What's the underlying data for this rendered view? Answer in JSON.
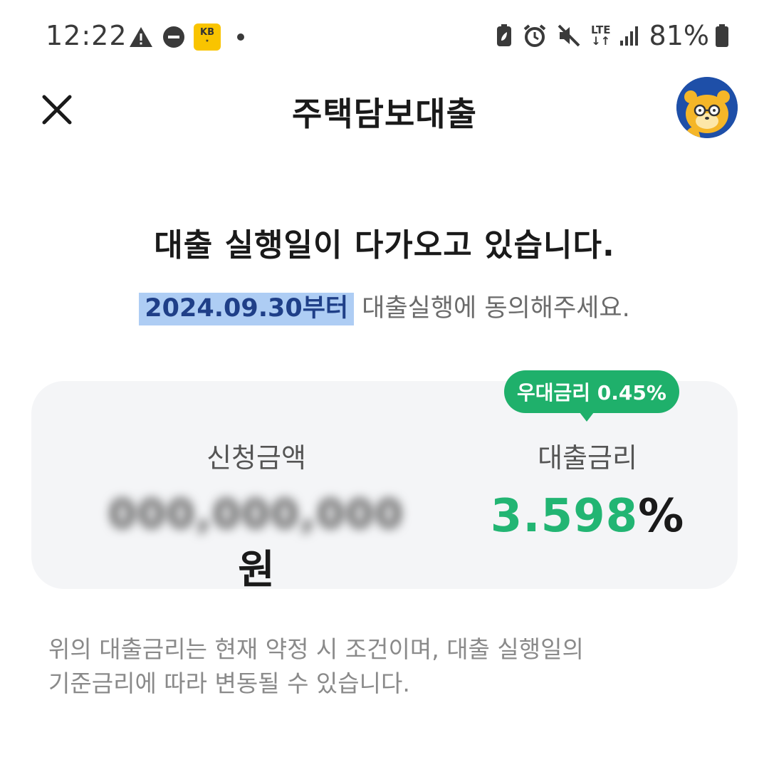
{
  "status_bar": {
    "time": "12:22",
    "battery_percent": "81%",
    "network": "LTE",
    "kb_badge": "KB",
    "icons": [
      "warning-icon",
      "dnd-icon",
      "kb-app-icon",
      "dot-icon",
      "battery-saver-icon",
      "alarm-icon",
      "mute-icon",
      "lte-icon",
      "signal-icon",
      "battery-icon"
    ]
  },
  "header": {
    "title": "주택담보대출",
    "close_icon": "close-icon",
    "avatar_icon": "character-avatar-icon"
  },
  "intro": {
    "headline": "대출 실행일이 다가오고 있습니다.",
    "date_highlight": "2024.09.30부터",
    "sub_text": " 대출실행에 동의해주세요."
  },
  "card": {
    "amount_label": "신청금액",
    "amount_value": "000,000,000",
    "amount_unit": "원",
    "rate_label": "대출금리",
    "rate_value": "3.598",
    "rate_unit": "%",
    "badge": "우대금리 0.45%"
  },
  "notice": {
    "line1": "위의 대출금리는 현재 약정 시 조건이며, 대출 실행일의",
    "line2": "기준금리에 따라 변동될 수 있습니다."
  },
  "colors": {
    "accent_green": "#22b573",
    "badge_green": "#1fb06b",
    "highlight_blue": "#aecdf4",
    "card_bg": "#f4f5f7"
  }
}
